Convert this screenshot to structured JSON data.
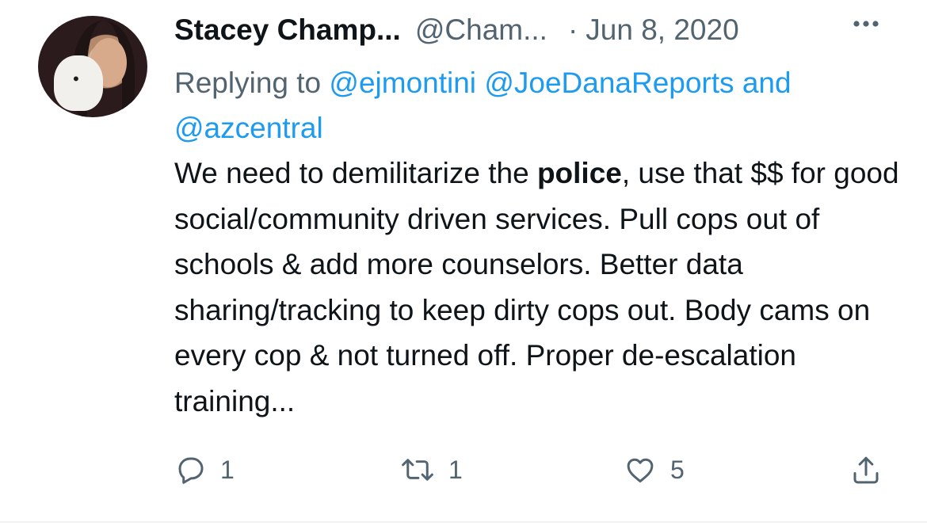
{
  "tweet": {
    "author_name": "Stacey Champ...",
    "author_handle": "@Cham...",
    "separator": "·",
    "date": "Jun 8, 2020",
    "more_icon": "more-horizontal-icon",
    "replying_prefix": "Replying to ",
    "mentions": [
      "@ejmontini",
      "@JoeDanaReports"
    ],
    "mention_joiner": " and",
    "last_mention": "@azcentral",
    "body_before_bold": "We need to demilitarize the ",
    "body_bold": "police",
    "body_after_bold": ", use that $$ for good social/community driven services. Pull cops out of schools & add more counselors. Better data sharing/tracking to keep dirty cops out. Body cams on every cop & not turned off. Proper de-escalation training...",
    "actions": {
      "reply_count": "1",
      "retweet_count": "1",
      "like_count": "5"
    },
    "icon_color": "#536471",
    "link_color": "#1d9bf0"
  }
}
